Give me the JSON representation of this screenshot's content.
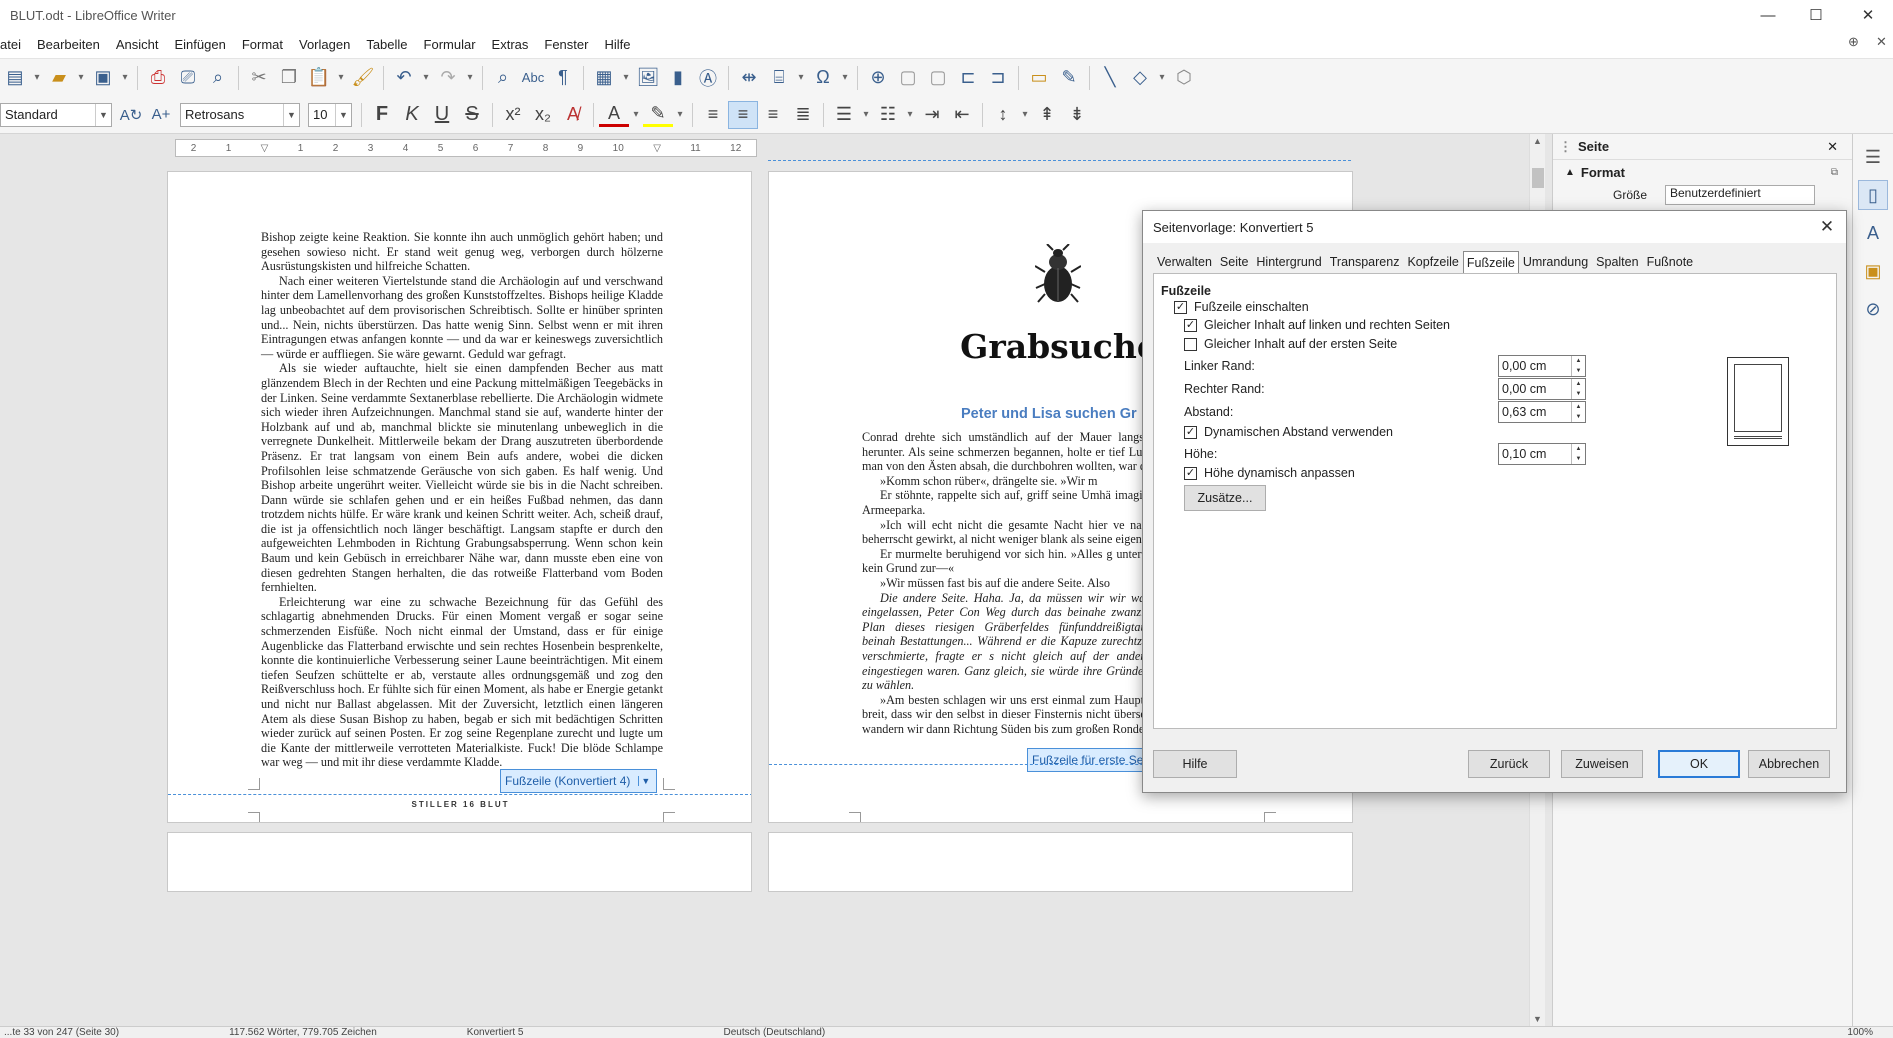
{
  "window": {
    "title": "BLUT.odt - LibreOffice Writer",
    "minimize": "—",
    "maximize": "☐",
    "close": "✕"
  },
  "menu": [
    "atei",
    "Bearbeiten",
    "Ansicht",
    "Einfügen",
    "Format",
    "Vorlagen",
    "Tabelle",
    "Formular",
    "Extras",
    "Fenster",
    "Hilfe"
  ],
  "formatting": {
    "style": "Standard",
    "font": "Retrosans",
    "size": "10"
  },
  "document": {
    "left_page": {
      "paragraphs": [
        "Bishop zeigte keine Reaktion. Sie konnte ihn auch unmöglich gehört haben; und gesehen sowieso nicht. Er stand weit genug weg, verborgen durch hölzerne Ausrüstungskisten und hilfreiche Schatten.",
        "Nach einer weiteren Viertelstunde stand die Archäologin auf und verschwand hinter dem Lamellenvorhang des großen Kunststoffzeltes. Bishops heilige Kladde lag unbeobachtet auf dem provisorischen Schreibtisch. Sollte er hinüber sprinten und... Nein, nichts überstürzen. Das hatte wenig Sinn. Selbst wenn er mit ihren Eintragungen etwas anfangen konnte — und da war er keineswegs zuversichtlich — würde er auffliegen. Sie wäre gewarnt. Geduld war gefragt.",
        "Als sie wieder auftauchte, hielt sie einen dampfenden Becher aus matt glänzendem Blech in der Rechten und eine Packung mittelmäßigen Teegebäcks in der Linken. Seine verdammte Sextanerblase rebellierte. Die Archäologin widmete sich wieder ihren Aufzeichnungen. Manchmal stand sie auf, wanderte hinter der Holzbank auf und ab, manchmal blickte sie minutenlang unbeweglich in die verregnete Dunkelheit. Mittlerweile bekam der Drang auszutreten überbordende Präsenz. Er trat langsam von einem Bein aufs andere, wobei die dicken Profilsohlen leise schmatzende Geräusche von sich gaben. Es half wenig. Und Bishop arbeite ungerührt weiter. Vielleicht würde sie bis in die Nacht schreiben. Dann würde sie schlafen gehen und er ein heißes Fußbad nehmen, das dann trotzdem nichts hülfe. Er wäre krank und keinen Schritt weiter. Ach, scheiß drauf, die ist ja offensichtlich noch länger beschäftigt. Langsam stapfte er durch den aufgeweichten Lehmboden in Richtung Grabungsabsperrung. Wenn schon kein Baum und kein Gebüsch in erreichbarer Nähe war, dann musste eben eine von diesen gedrehten Stangen herhalten, die das rotweiße Flatterband vom Boden fernhielten.",
        "Erleichterung war eine zu schwache Bezeichnung für das Gefühl des schlagartig abnehmenden Drucks. Für einen Moment vergaß er sogar seine schmerzenden Eisfüße. Noch nicht einmal der Umstand, dass er für einige Augenblicke das Flatterband erwischte und sein rechtes Hosenbein besprenkelte, konnte die kontinuierliche Verbesserung seiner Laune beeinträchtigen. Mit einem tiefen Seufzen schüttelte er ab, verstaute alles ordnungsgemäß und zog den Reißverschluss hoch. Er fühlte sich für einen Moment, als habe er Energie getankt und nicht nur Ballast abgelassen. Mit der Zuversicht, letztlich einen längeren Atem als diese Susan Bishop zu haben, begab er sich mit bedächtigen Schritten wieder zurück auf seinen Posten. Er zog seine Regenplane zurecht und lugte um die Kante der mittlerweile verrotteten Materialkiste. Fuck! Die blöde Schlampe war weg — und mit ihr diese verdammte Kladde."
      ],
      "footer_tag": "Fußzeile (Konvertiert 4)",
      "footer_text": "STILLER  16  BLUT"
    },
    "right_page": {
      "chapter_title": "Grabsuche",
      "heading": "Peter und Lisa suchen Gr",
      "paragraphs": [
        "Conrad drehte sich umständlich auf der Mauer langsam an der Ziegelwand herunter. Als seine schmerzen begannen, holte er tief Luft und ließ s recht, wenn man von den Ästen absah, die durchbohren wollten, war die Landung erträglich.",
        "»Komm schon rüber«, drängelte sie. »Wir m",
        "Er stöhnte, rappelte sich auf, griff seine Umhä imaginären Dreck von seinem Armeeparka.",
        "»Ich will echt nicht die gesamte Nacht hier ve nach. Bislang hatte sie so beherrscht gewirkt, al nicht weniger blank als seine eigenen.",
        "Er murmelte beruhigend vor sich hin. »Alles g unterwegs, ich komme schon, kein Grund zur—«",
        "»Wir müssen fast bis auf die andere Seite. Also",
        "Die andere Seite. Haha. Ja, da müssen wir wir was hast du dich da bloß eingelassen, Peter Con Weg durch das beinahe zwanzig Hektar umfassen den Plan dieses riesigen Gräberfeldes fünfunddreißigtausend Grabmonumente, beinah Bestattungen... Während er die Kapuze zurechtz Regen auf seiner Brille verschmierte, fragte er s nicht gleich auf der anderen Seite des Geländes eingestiegen waren. Ganz gleich, sie würde ihre Gründe haben, den langen Weg zu wählen.",
        "»Am besten schlagen wir uns erst einmal zum Hauptweg durch. Der ist ja so breit, dass wir den selbst in dieser Finsternis nicht übersehen können. Von da aus wandern wir dann Richtung Süden bis zum großen Rondell. Hast du"
      ],
      "footer_tag": "Fußzeile für erste Seite (Konvertiert 5)"
    }
  },
  "sidebar": {
    "title": "Seite",
    "section": "Format",
    "partial_label": "Größe",
    "partial_value": "Benutzerdefiniert"
  },
  "dialog": {
    "title": "Seitenvorlage: Konvertiert 5",
    "tabs": [
      "Verwalten",
      "Seite",
      "Hintergrund",
      "Transparenz",
      "Kopfzeile",
      "Fußzeile",
      "Umrandung",
      "Spalten",
      "Fußnote"
    ],
    "active_tab": "Fußzeile",
    "section_title": "Fußzeile",
    "checkboxes": {
      "enable": {
        "label": "Fußzeile einschalten",
        "checked": true
      },
      "same_lr": {
        "label": "Gleicher Inhalt auf linken und rechten Seiten",
        "checked": true
      },
      "same_first": {
        "label": "Gleicher Inhalt auf der ersten Seite",
        "checked": false
      },
      "dyn_spacing": {
        "label": "Dynamischen Abstand verwenden",
        "checked": true
      },
      "dyn_height": {
        "label": "Höhe dynamisch anpassen",
        "checked": true
      }
    },
    "fields": {
      "left_margin": {
        "label": "Linker Rand:",
        "value": "0,00 cm"
      },
      "right_margin": {
        "label": "Rechter Rand:",
        "value": "0,00 cm"
      },
      "spacing": {
        "label": "Abstand:",
        "value": "0,63 cm"
      },
      "height": {
        "label": "Höhe:",
        "value": "0,10 cm"
      }
    },
    "more_button": "Zusätze...",
    "buttons": {
      "help": "Hilfe",
      "reset": "Zurück",
      "apply": "Zuweisen",
      "ok": "OK",
      "cancel": "Abbrechen"
    }
  },
  "status": {
    "page": "...te 33 von 247 (Seite 30)",
    "words": "117.562 Wörter, 779.705 Zeichen",
    "style": "Konvertiert 5",
    "language": "Deutsch (Deutschland)",
    "zoom": "100%"
  }
}
